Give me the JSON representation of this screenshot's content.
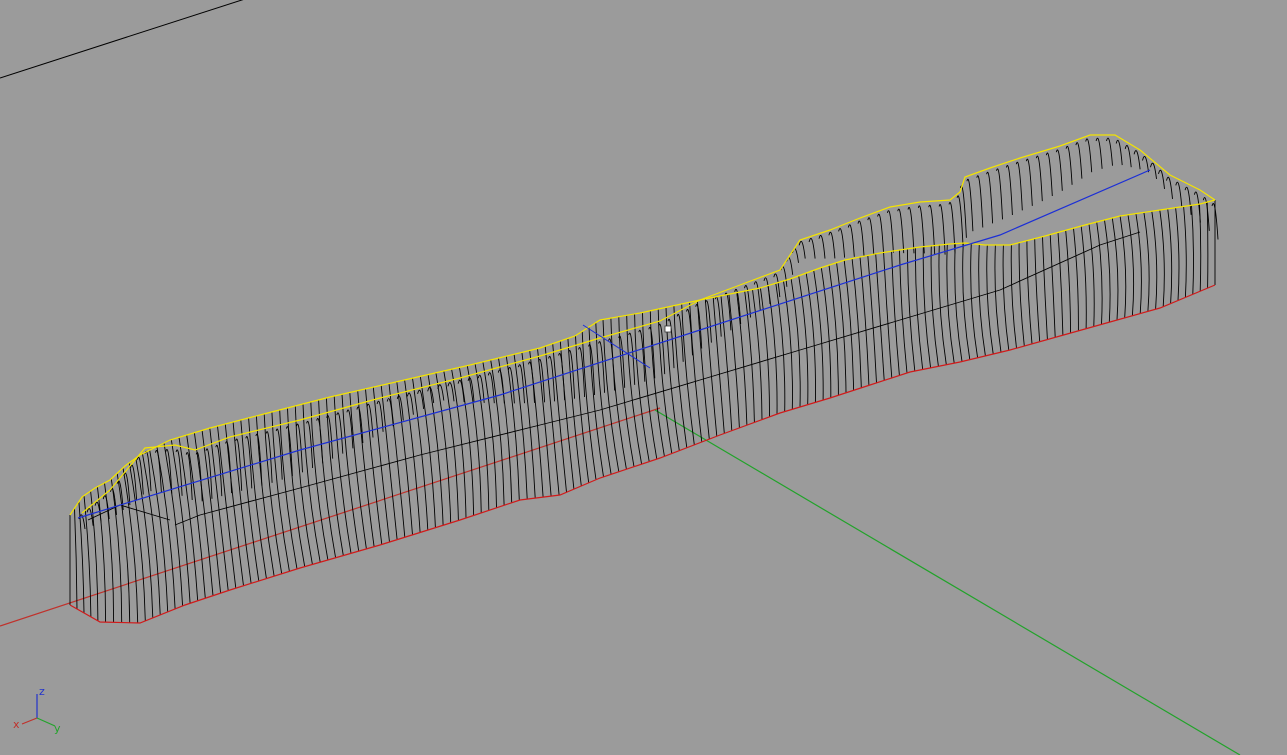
{
  "viewport": {
    "background_color": "#9b9b9b",
    "curve_color": "#000000",
    "rail_top_color": "#f4e400",
    "rail_bottom_color": "#d11a1a",
    "centerline_color": "#1c2fd6",
    "grid_y_axis_color": "#22a32a",
    "grid_x_axis_color": "#c0312b",
    "selection_marker_color": "#ffffff"
  },
  "axis_gizmo": {
    "x_label": "x",
    "y_label": "y",
    "z_label": "z",
    "x_color": "#c0312b",
    "y_color": "#22a32a",
    "z_color": "#2233cc"
  },
  "icons": {
    "axis_gizmo": "world-axes-icon",
    "control_point": "control-point-icon"
  }
}
